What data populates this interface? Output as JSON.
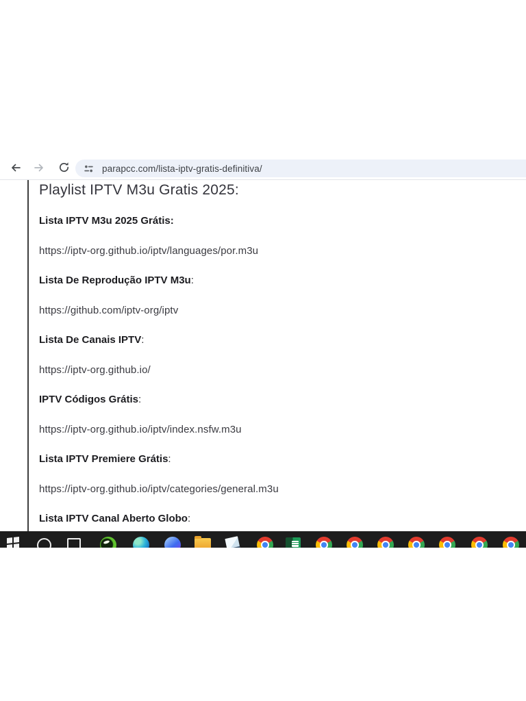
{
  "browser": {
    "url": "parapcc.com/lista-iptv-gratis-definitiva/",
    "back_icon": "back-arrow",
    "forward_icon": "forward-arrow",
    "reload_icon": "reload",
    "site_info_icon": "tune-sliders"
  },
  "page": {
    "heading": "Playlist IPTV M3u Gratis 2025:",
    "sections": [
      {
        "bold": "Lista IPTV M3u 2025 Grátis:",
        "colon": "",
        "url": "https://iptv-org.github.io/iptv/languages/por.m3u"
      },
      {
        "bold": "Lista De Reprodução IPTV M3u",
        "colon": ":",
        "url": "https://github.com/iptv-org/iptv"
      },
      {
        "bold": "Lista De Canais IPTV",
        "colon": ":",
        "url": "https://iptv-org.github.io/"
      },
      {
        "bold": "IPTV Códigos Grátis",
        "colon": ":",
        "url": "https://iptv-org.github.io/iptv/index.nsfw.m3u"
      },
      {
        "bold": "Lista IPTV Premiere Grátis",
        "colon": ":",
        "url": "https://iptv-org.github.io/iptv/categories/general.m3u"
      },
      {
        "bold": "Lista IPTV Canal Aberto Globo",
        "colon": ":",
        "url": ""
      }
    ]
  },
  "taskbar": {
    "background": "#1d1d1d",
    "icons": [
      "windows-start",
      "search",
      "task-view",
      "green-app",
      "edge",
      "copilot",
      "file-explorer",
      "notepad",
      "chrome",
      "excel",
      "chrome",
      "chrome",
      "chrome",
      "chrome",
      "chrome",
      "chrome",
      "chrome"
    ]
  },
  "colors": {
    "omnibox_bg": "#edf1f9",
    "url_text": "#3f4247",
    "heading_text": "#34343c",
    "body_text": "#3a3a40",
    "taskbar_bg": "#1d1d1d"
  }
}
